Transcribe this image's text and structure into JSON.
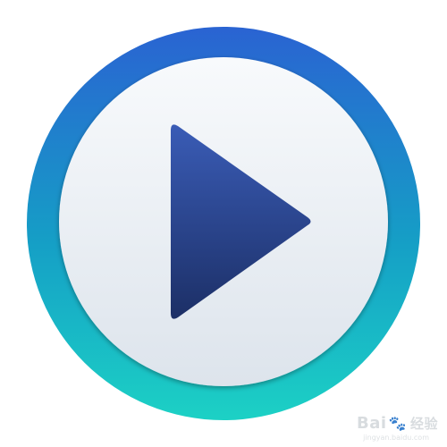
{
  "icon": {
    "name": "media-player-play-icon",
    "ring_gradient": [
      "#2a63d2",
      "#159fc6",
      "#1cd1c5"
    ],
    "face_gradient": [
      "#f8fafc",
      "#dde4ec"
    ],
    "triangle_gradient": [
      "#3a5cb6",
      "#1c2f66"
    ]
  },
  "watermark": {
    "brand_left": "Bai",
    "brand_paw": "🐾",
    "brand_right": "经验",
    "url": "jingyan.baidu.com"
  }
}
